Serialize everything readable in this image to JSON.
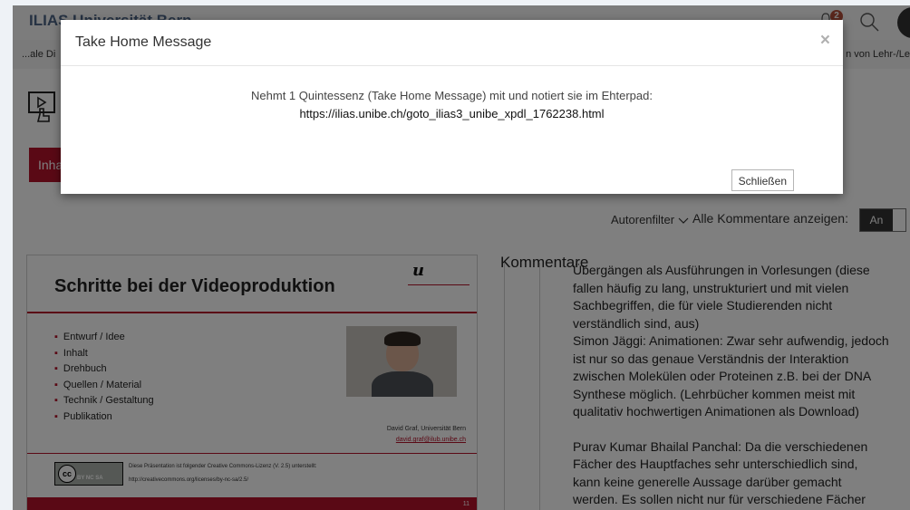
{
  "header": {
    "brand": "ILIAS Universität Bern",
    "notification_count": "2"
  },
  "breadcrumb": {
    "left": "...ale Di",
    "right": "n von Lehr-/Le"
  },
  "tabs": {
    "active_partial": "Inha"
  },
  "filter": {
    "autorenfilter": "Autorenfilter",
    "show_all_label": "Alle Kommentare anzeigen:",
    "toggle_on": "An"
  },
  "slide": {
    "title": "Schritte bei der Videoproduktion",
    "logo": "u",
    "bullets": [
      "Entwurf / Idee",
      "Inhalt",
      "Drehbuch",
      "Quellen / Material",
      "Technik / Gestaltung",
      "Publikation"
    ],
    "author": "David Graf, Universität Bern",
    "email": "david.graf@ilub.unibe.ch",
    "cc_label": "BY NC SA",
    "license_text": "Diese Präsentation ist folgender Creative Commons-Lizenz (V. 2.5) unterstellt:",
    "license_url": "http://creativecommons.org/licenses/by-nc-sa/2.5/",
    "page_number": "11"
  },
  "comments": {
    "heading": "Kommentare",
    "lines": [
      "Übergängen als Ausführungen in Vorlesungen (diese",
      "fallen häufig zu lang, unstrukturiert und mit vielen",
      "Sachbegriffen, die für viele Studierenden nicht",
      "verständlich sind, aus)",
      "Simon Jäggi: Animationen: Zwar sehr aufwendig, jedoch",
      "ist nur so das genaue Verständnis der Interaktion",
      "zwischen Molekülen oder Proteinen z.B. bei der DNA",
      "Synthese möglich. (Lehrbücher kommen meist mit",
      "qualitativ hochwertigen Animationen als Download)",
      "",
      "Purav Kumar Bhailal Panchal: Da die verschiedenen",
      "Fächer des Hauptfaches sehr unterschiedlich sind,",
      "kann keine generelle Aussage darüber gemacht",
      "werden. Es sollen nicht nur für verschiedene Fächer"
    ]
  },
  "modal": {
    "title": "Take Home Message",
    "close_symbol": "×",
    "message": "Nehmt 1 Quintessenz (Take Home Message) mit und notiert sie im Ehterpad:",
    "link": "https://ilias.unibe.ch/goto_ilias3_unibe_xpdl_1762238.html",
    "close_button": "Schließen"
  }
}
